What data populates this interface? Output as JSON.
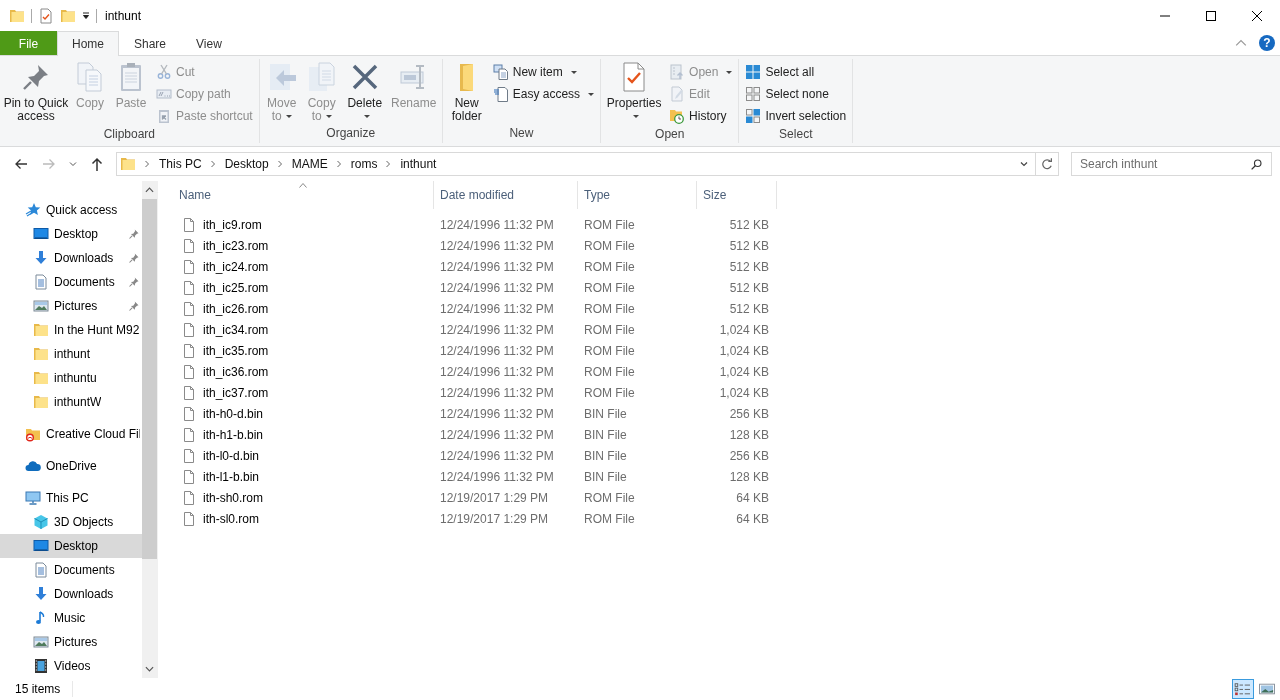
{
  "title_bar": {
    "title": "inthunt"
  },
  "help_button": {
    "label": "?"
  },
  "ribbon_tabs": [
    {
      "label": "File",
      "kind": "menu",
      "selected": false
    },
    {
      "label": "Home",
      "kind": "tab",
      "selected": true
    },
    {
      "label": "Share",
      "kind": "tab",
      "selected": false
    },
    {
      "label": "View",
      "kind": "tab",
      "selected": false
    }
  ],
  "ribbon": {
    "groups": [
      {
        "label": "Clipboard",
        "items": [
          {
            "label": "Pin to Quick access",
            "kind": "large",
            "disabled": false,
            "dropdown": false
          },
          {
            "label": "Copy",
            "kind": "large",
            "disabled": true,
            "dropdown": false
          },
          {
            "label": "Paste",
            "kind": "large",
            "disabled": true,
            "dropdown": false
          },
          {
            "label": "Cut",
            "kind": "small",
            "disabled": true,
            "dropdown": false
          },
          {
            "label": "Copy path",
            "kind": "small",
            "disabled": true,
            "dropdown": false
          },
          {
            "label": "Paste shortcut",
            "kind": "small",
            "disabled": true,
            "dropdown": false
          }
        ]
      },
      {
        "label": "Organize",
        "items": [
          {
            "label": "Move to",
            "kind": "large",
            "disabled": true,
            "dropdown": true
          },
          {
            "label": "Copy to",
            "kind": "large",
            "disabled": true,
            "dropdown": true
          },
          {
            "label": "Delete",
            "kind": "large",
            "disabled": false,
            "dropdown": true
          },
          {
            "label": "Rename",
            "kind": "large",
            "disabled": true,
            "dropdown": false
          }
        ]
      },
      {
        "label": "New",
        "items": [
          {
            "label": "New folder",
            "kind": "large",
            "disabled": false,
            "dropdown": false
          },
          {
            "label": "New item",
            "kind": "small",
            "disabled": false,
            "dropdown": true
          },
          {
            "label": "Easy access",
            "kind": "small",
            "disabled": false,
            "dropdown": true
          }
        ]
      },
      {
        "label": "Open",
        "items": [
          {
            "label": "Properties",
            "kind": "large",
            "disabled": false,
            "dropdown": true
          },
          {
            "label": "Open",
            "kind": "small",
            "disabled": true,
            "dropdown": true
          },
          {
            "label": "Edit",
            "kind": "small",
            "disabled": true,
            "dropdown": false
          },
          {
            "label": "History",
            "kind": "small",
            "disabled": false,
            "dropdown": false
          }
        ]
      },
      {
        "label": "Select",
        "items": [
          {
            "label": "Select all",
            "kind": "small",
            "disabled": false,
            "dropdown": false
          },
          {
            "label": "Select none",
            "kind": "small",
            "disabled": false,
            "dropdown": false
          },
          {
            "label": "Invert selection",
            "kind": "small",
            "disabled": false,
            "dropdown": false
          }
        ]
      }
    ]
  },
  "address_bar": {
    "crumbs": [
      "This PC",
      "Desktop",
      "MAME",
      "roms",
      "inthunt"
    ]
  },
  "search": {
    "placeholder": "Search inthunt"
  },
  "sidebar": {
    "items": [
      {
        "label": "Quick access",
        "kind": "star",
        "selected": false,
        "children": [
          {
            "label": "Desktop",
            "kind": "desktop",
            "selected": false,
            "pinned": true
          },
          {
            "label": "Downloads",
            "kind": "downloads",
            "selected": false,
            "pinned": true
          },
          {
            "label": "Documents",
            "kind": "documents",
            "selected": false,
            "pinned": true
          },
          {
            "label": "Pictures",
            "kind": "pictures",
            "selected": false,
            "pinned": true
          },
          {
            "label": "In the Hunt M92",
            "kind": "folder",
            "selected": false,
            "pinned": false
          },
          {
            "label": "inthunt",
            "kind": "folder",
            "selected": false,
            "pinned": false
          },
          {
            "label": "inthuntu",
            "kind": "folder",
            "selected": false,
            "pinned": false
          },
          {
            "label": "inthuntW",
            "kind": "folder",
            "selected": false,
            "pinned": false
          }
        ]
      },
      {
        "label": "Creative Cloud Fil",
        "kind": "cloud-files",
        "selected": false
      },
      {
        "label": "OneDrive",
        "kind": "onedrive",
        "selected": false
      },
      {
        "label": "This PC",
        "kind": "computer",
        "selected": false,
        "children": [
          {
            "label": "3D Objects",
            "kind": "cube",
            "selected": false
          },
          {
            "label": "Desktop",
            "kind": "desktop",
            "selected": true
          },
          {
            "label": "Documents",
            "kind": "documents",
            "selected": false
          },
          {
            "label": "Downloads",
            "kind": "downloads",
            "selected": false
          },
          {
            "label": "Music",
            "kind": "music",
            "selected": false
          },
          {
            "label": "Pictures",
            "kind": "pictures",
            "selected": false
          },
          {
            "label": "Videos",
            "kind": "videos",
            "selected": false
          }
        ]
      }
    ]
  },
  "file_list": {
    "columns": [
      {
        "label": "Name",
        "sorted": true
      },
      {
        "label": "Date modified",
        "sorted": false
      },
      {
        "label": "Type",
        "sorted": false
      },
      {
        "label": "Size",
        "sorted": false
      }
    ],
    "rows": [
      {
        "name": "ith_ic9.rom",
        "date": "12/24/1996 11:32 PM",
        "type": "ROM File",
        "size": "512 KB"
      },
      {
        "name": "ith_ic23.rom",
        "date": "12/24/1996 11:32 PM",
        "type": "ROM File",
        "size": "512 KB"
      },
      {
        "name": "ith_ic24.rom",
        "date": "12/24/1996 11:32 PM",
        "type": "ROM File",
        "size": "512 KB"
      },
      {
        "name": "ith_ic25.rom",
        "date": "12/24/1996 11:32 PM",
        "type": "ROM File",
        "size": "512 KB"
      },
      {
        "name": "ith_ic26.rom",
        "date": "12/24/1996 11:32 PM",
        "type": "ROM File",
        "size": "512 KB"
      },
      {
        "name": "ith_ic34.rom",
        "date": "12/24/1996 11:32 PM",
        "type": "ROM File",
        "size": "1,024 KB"
      },
      {
        "name": "ith_ic35.rom",
        "date": "12/24/1996 11:32 PM",
        "type": "ROM File",
        "size": "1,024 KB"
      },
      {
        "name": "ith_ic36.rom",
        "date": "12/24/1996 11:32 PM",
        "type": "ROM File",
        "size": "1,024 KB"
      },
      {
        "name": "ith_ic37.rom",
        "date": "12/24/1996 11:32 PM",
        "type": "ROM File",
        "size": "1,024 KB"
      },
      {
        "name": "ith-h0-d.bin",
        "date": "12/24/1996 11:32 PM",
        "type": "BIN File",
        "size": "256 KB"
      },
      {
        "name": "ith-h1-b.bin",
        "date": "12/24/1996 11:32 PM",
        "type": "BIN File",
        "size": "128 KB"
      },
      {
        "name": "ith-l0-d.bin",
        "date": "12/24/1996 11:32 PM",
        "type": "BIN File",
        "size": "256 KB"
      },
      {
        "name": "ith-l1-b.bin",
        "date": "12/24/1996 11:32 PM",
        "type": "BIN File",
        "size": "128 KB"
      },
      {
        "name": "ith-sh0.rom",
        "date": "12/19/2017 1:29 PM",
        "type": "ROM File",
        "size": "64 KB"
      },
      {
        "name": "ith-sl0.rom",
        "date": "12/19/2017 1:29 PM",
        "type": "ROM File",
        "size": "64 KB"
      }
    ]
  },
  "status_bar": {
    "item_count": "15 items"
  },
  "view_buttons": [
    {
      "kind": "details",
      "selected": true
    },
    {
      "kind": "large-icons",
      "selected": false
    }
  ]
}
